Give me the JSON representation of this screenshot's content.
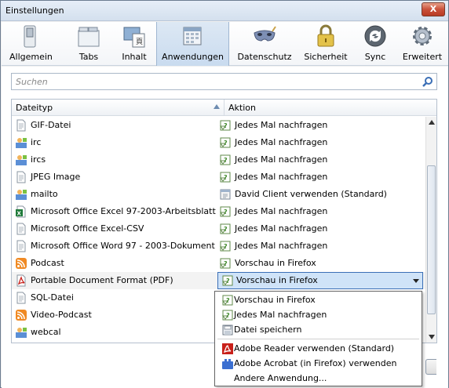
{
  "window": {
    "title": "Einstellungen",
    "close_label": "X"
  },
  "toolbar": {
    "items": [
      {
        "label": "Allgemein",
        "icon": "switch-icon"
      },
      {
        "label": "Tabs",
        "icon": "tabs-icon"
      },
      {
        "label": "Inhalt",
        "icon": "content-icon"
      },
      {
        "label": "Anwendungen",
        "icon": "applications-icon",
        "selected": true
      },
      {
        "label": "Datenschutz",
        "icon": "mask-icon"
      },
      {
        "label": "Sicherheit",
        "icon": "padlock-icon"
      },
      {
        "label": "Sync",
        "icon": "sync-icon"
      },
      {
        "label": "Erweitert",
        "icon": "gear-icon"
      }
    ]
  },
  "search": {
    "placeholder": "Suchen"
  },
  "table": {
    "headers": {
      "type": "Dateityp",
      "action": "Aktion"
    },
    "rows": [
      {
        "type": "GIF-Datei",
        "type_icon": "file-icon",
        "action": "Jedes Mal nachfragen",
        "action_icon": "ask-icon"
      },
      {
        "type": "irc",
        "type_icon": "chat-icon",
        "action": "Jedes Mal nachfragen",
        "action_icon": "ask-icon"
      },
      {
        "type": "ircs",
        "type_icon": "chat-icon",
        "action": "Jedes Mal nachfragen",
        "action_icon": "ask-icon"
      },
      {
        "type": "JPEG Image",
        "type_icon": "file-icon",
        "action": "Jedes Mal nachfragen",
        "action_icon": "ask-icon"
      },
      {
        "type": "mailto",
        "type_icon": "chat-icon",
        "action": "David Client verwenden (Standard)",
        "action_icon": "app-icon"
      },
      {
        "type": "Microsoft Office Excel 97-2003-Arbeitsblatt",
        "type_icon": "excel-icon",
        "action": "Jedes Mal nachfragen",
        "action_icon": "ask-icon"
      },
      {
        "type": "Microsoft Office Excel-CSV",
        "type_icon": "file-icon",
        "action": "Jedes Mal nachfragen",
        "action_icon": "ask-icon"
      },
      {
        "type": "Microsoft Office Word 97 - 2003-Dokument",
        "type_icon": "file-icon",
        "action": "Jedes Mal nachfragen",
        "action_icon": "ask-icon"
      },
      {
        "type": "Podcast",
        "type_icon": "rss-icon",
        "action": "Vorschau in Firefox",
        "action_icon": "ask-icon"
      },
      {
        "type": "Portable Document Format (PDF)",
        "type_icon": "pdf-icon",
        "action": "Vorschau in Firefox",
        "action_icon": "ask-icon",
        "selected": true
      },
      {
        "type": "SQL-Datei",
        "type_icon": "file-icon",
        "action": "",
        "action_icon": ""
      },
      {
        "type": "Video-Podcast",
        "type_icon": "rss-icon",
        "action": "",
        "action_icon": ""
      },
      {
        "type": "webcal",
        "type_icon": "chat-icon",
        "action": "",
        "action_icon": ""
      }
    ]
  },
  "dropdown": {
    "items": [
      {
        "label": "Vorschau in Firefox",
        "icon": "ask-icon"
      },
      {
        "label": "Jedes Mal nachfragen",
        "icon": "ask-icon"
      },
      {
        "label": "Datei speichern",
        "icon": "save-icon"
      },
      {
        "label": "Adobe Reader  verwenden (Standard)",
        "icon": "pdf-icon"
      },
      {
        "label": "Adobe Acrobat (in Firefox) verwenden",
        "icon": "plugin-icon"
      },
      {
        "label": "Andere Anwendung...",
        "icon": ""
      }
    ]
  },
  "colors": {
    "selection": "#cfe3f8",
    "selected_tab": "#c9dbef",
    "accent": "#3b6fb6"
  }
}
